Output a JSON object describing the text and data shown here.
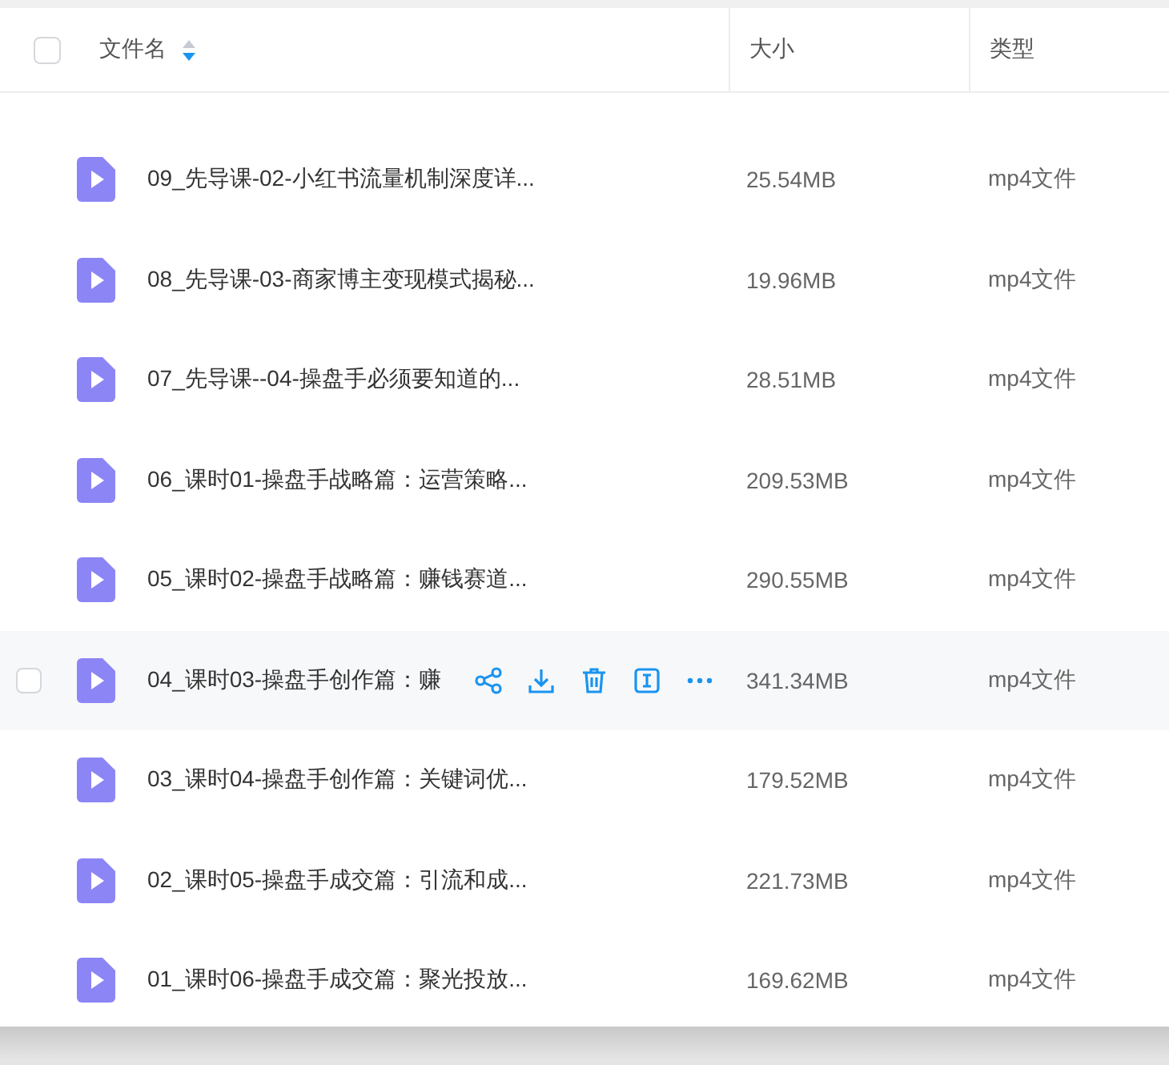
{
  "header": {
    "checked": false,
    "columns": [
      {
        "label": "文件名",
        "sort_descending": true
      },
      {
        "label": "大小"
      },
      {
        "label": "类型"
      }
    ]
  },
  "rows": [
    {
      "name": "09_先导课-02-小红书流量机制深度详...",
      "size": "25.54MB",
      "type": "mp4文件",
      "hovered": false
    },
    {
      "name": "08_先导课-03-商家博主变现模式揭秘...",
      "size": "19.96MB",
      "type": "mp4文件",
      "hovered": false
    },
    {
      "name": "07_先导课--04-操盘手必须要知道的...",
      "size": "28.51MB",
      "type": "mp4文件",
      "hovered": false
    },
    {
      "name": "06_课时01-操盘手战略篇：运营策略...",
      "size": "209.53MB",
      "type": "mp4文件",
      "hovered": false
    },
    {
      "name": "05_课时02-操盘手战略篇：赚钱赛道...",
      "size": "290.55MB",
      "type": "mp4文件",
      "hovered": false
    },
    {
      "name": "04_课时03-操盘手创作篇：赚",
      "size": "341.34MB",
      "type": "mp4文件",
      "hovered": true,
      "checked": false
    },
    {
      "name": "03_课时04-操盘手创作篇：关键词优...",
      "size": "179.52MB",
      "type": "mp4文件",
      "hovered": false
    },
    {
      "name": "02_课时05-操盘手成交篇：引流和成...",
      "size": "221.73MB",
      "type": "mp4文件",
      "hovered": false
    },
    {
      "name": "01_课时06-操盘手成交篇：聚光投放...",
      "size": "169.62MB",
      "type": "mp4文件",
      "hovered": false
    }
  ]
}
